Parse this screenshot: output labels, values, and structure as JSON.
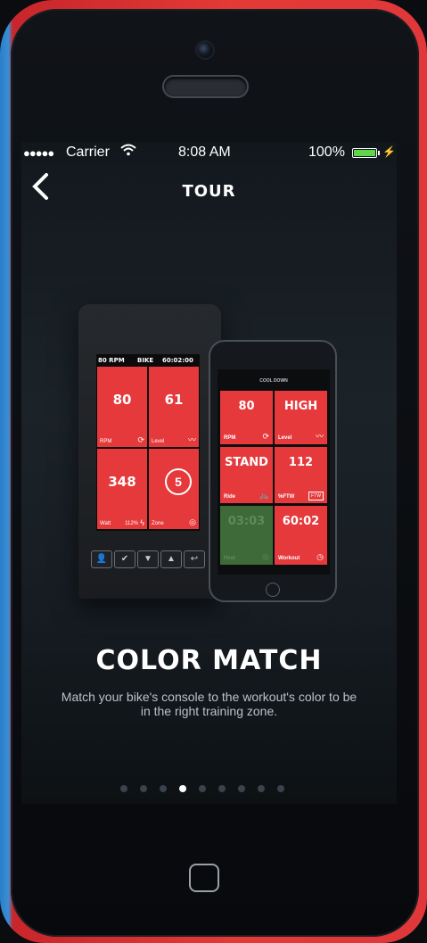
{
  "status_bar": {
    "signal": "●●●●●",
    "carrier": "Carrier",
    "time": "8:08 AM",
    "battery_percent": "100%",
    "battery_level": 1.0
  },
  "nav": {
    "back_icon": "chevron-left-icon",
    "title": "TOUR"
  },
  "console": {
    "header_left": "80 RPM",
    "header_mid": "BIKE",
    "header_right": "60:02:00",
    "tiles": [
      {
        "value": "80",
        "label": "RPM",
        "icon": "refresh-icon"
      },
      {
        "value": "61",
        "label": "Level",
        "icon": "graph-icon"
      },
      {
        "value": "348",
        "label": "Watt",
        "extra": "112%",
        "icon": "bolt-icon"
      },
      {
        "value": "5",
        "label": "Zone",
        "icon": "target-icon"
      }
    ],
    "buttons": [
      "user-icon",
      "check-icon",
      "down-icon",
      "up-icon",
      "return-icon"
    ]
  },
  "mini_phone": {
    "title": "COOL DOWN",
    "tiles": [
      {
        "value": "80",
        "label": "RPM",
        "icon": "refresh-icon"
      },
      {
        "value": "HIGH",
        "label": "Level",
        "icon": "graph-icon"
      },
      {
        "value": "STAND",
        "label": "Ride",
        "icon": "bike-icon"
      },
      {
        "value": "112",
        "label": "%FTW",
        "icon": "ftw-badge"
      },
      {
        "value": "03:03",
        "label": "Heat",
        "icon": "timer-icon"
      },
      {
        "value": "60:02",
        "label": "Workout",
        "icon": "clock-icon"
      }
    ]
  },
  "content": {
    "headline": "COLOR MATCH",
    "description": "Match your bike's console to the workout's color to be in the right training zone."
  },
  "pager": {
    "count": 9,
    "active_index": 3
  },
  "colors": {
    "accent_red": "#e5393c",
    "battery_green": "#5fd64a"
  }
}
